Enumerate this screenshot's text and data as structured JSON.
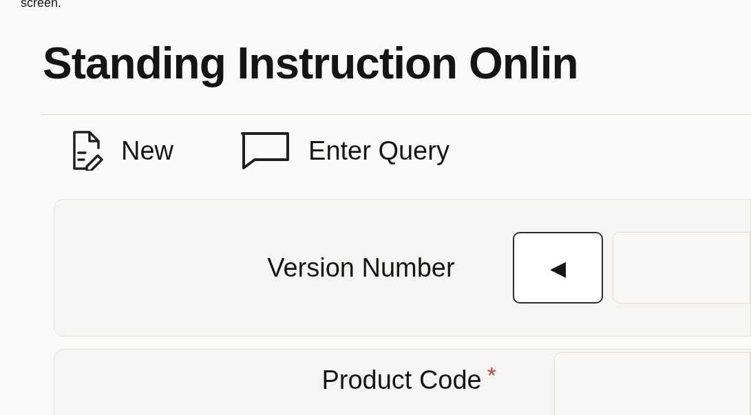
{
  "caption": "screen.",
  "title": "Standing Instruction Onlin",
  "toolbar": [
    {
      "kind": "new",
      "label": "New"
    },
    {
      "kind": "query",
      "label": "Enter Query"
    }
  ],
  "version": {
    "label": "Version Number",
    "prev_symbol": "◀"
  },
  "product_code": {
    "label": "Product Code",
    "required_mark": "*"
  }
}
